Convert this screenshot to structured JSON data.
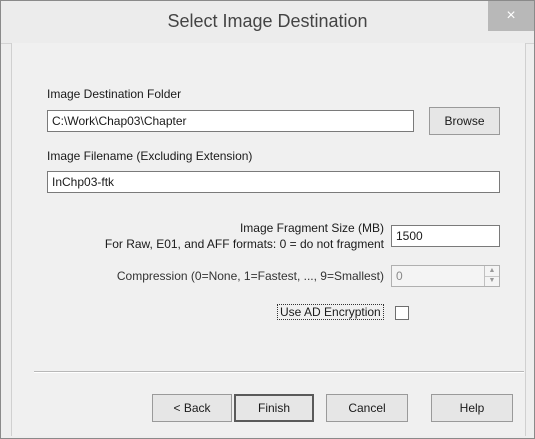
{
  "dialog": {
    "title": "Select Image Destination",
    "close_label": "×"
  },
  "destination": {
    "label": "Image Destination Folder",
    "value": "C:\\Work\\Chap03\\Chapter",
    "browse_label": "Browse"
  },
  "filename": {
    "label": "Image Filename (Excluding Extension)",
    "value": "InChp03-ftk"
  },
  "fragment": {
    "label_line1": "Image Fragment Size (MB)",
    "label_line2": "For Raw, E01, and AFF formats: 0 = do not fragment",
    "value": "1500"
  },
  "compression": {
    "label": "Compression (0=None, 1=Fastest, ..., 9=Smallest)",
    "value": "0",
    "up_icon": "▲",
    "down_icon": "▼"
  },
  "encryption": {
    "label": "Use AD Encryption",
    "checked": false
  },
  "buttons": {
    "back": "< Back",
    "finish": "Finish",
    "cancel": "Cancel",
    "help": "Help"
  }
}
